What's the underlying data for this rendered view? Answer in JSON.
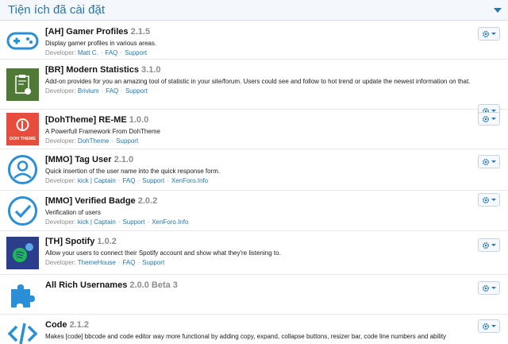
{
  "header": {
    "title": "Tiện ích đã cài đặt"
  },
  "addons": [
    {
      "title": "[AH] Gamer Profiles",
      "version": "2.1.5",
      "description": "Display gamer profiles in various areas.",
      "dev_prefix": "Developer:",
      "links": [
        "Matt C.",
        "FAQ",
        "Support"
      ],
      "icon": "gamepad-icon"
    },
    {
      "title": "[BR] Modern Statistics",
      "version": "3.1.0",
      "description": "Add-on provides for you an amazing tool of statistic in your site/forum. Users could see and follow to hot trend or update the newest information on that.",
      "dev_prefix": "Developer:",
      "links": [
        "Brivium",
        "FAQ",
        "Support"
      ],
      "icon": "statistics-icon"
    },
    {
      "title": "[DohTheme] RE-ME",
      "version": "1.0.0",
      "description": "A Powerfull Framework From DohTheme",
      "dev_prefix": "Developer:",
      "links": [
        "DohTheme",
        "Support"
      ],
      "icon": "dohtheme-logo",
      "icon_label": "DOH THEME"
    },
    {
      "title": "[MMO] Tag User",
      "version": "2.1.0",
      "description": "Quick insertion of the user name into the quick response form.",
      "dev_prefix": "Developer:",
      "links": [
        "kick | Captain",
        "FAQ",
        "Support",
        "XenForo.Info"
      ],
      "icon": "user-circle-icon"
    },
    {
      "title": "[MMO] Verified Badge",
      "version": "2.0.2",
      "description": "Verification of users",
      "dev_prefix": "Developer:",
      "links": [
        "kick | Captain",
        "Support",
        "XenForo.Info"
      ],
      "icon": "check-circle-icon"
    },
    {
      "title": "[TH] Spotify",
      "version": "1.0.2",
      "description": "Allow your users to connect their Spotify account and show what they're listening to.",
      "dev_prefix": "Developer:",
      "links": [
        "ThemeHouse",
        "FAQ",
        "Support"
      ],
      "icon": "spotify-icon"
    },
    {
      "title": "All Rich Usernames",
      "version": "2.0.0 Beta 3",
      "description": "",
      "dev_prefix": "",
      "links": [],
      "icon": "puzzle-icon"
    },
    {
      "title": "Code",
      "version": "2.1.2",
      "description": "Makes [code] bbcode and code editor way more functional by adding copy, expand, collapse buttons, resizer bar, code line numbers and ability",
      "dev_prefix": "",
      "links": [],
      "icon": "code-icon"
    }
  ],
  "colors": {
    "accent": "#2577b1",
    "stats_bg": "#4f7a36",
    "doh_bg": "#e74c3c",
    "spotify_bg": "#2b3e8c",
    "spotify_green": "#1db954"
  }
}
